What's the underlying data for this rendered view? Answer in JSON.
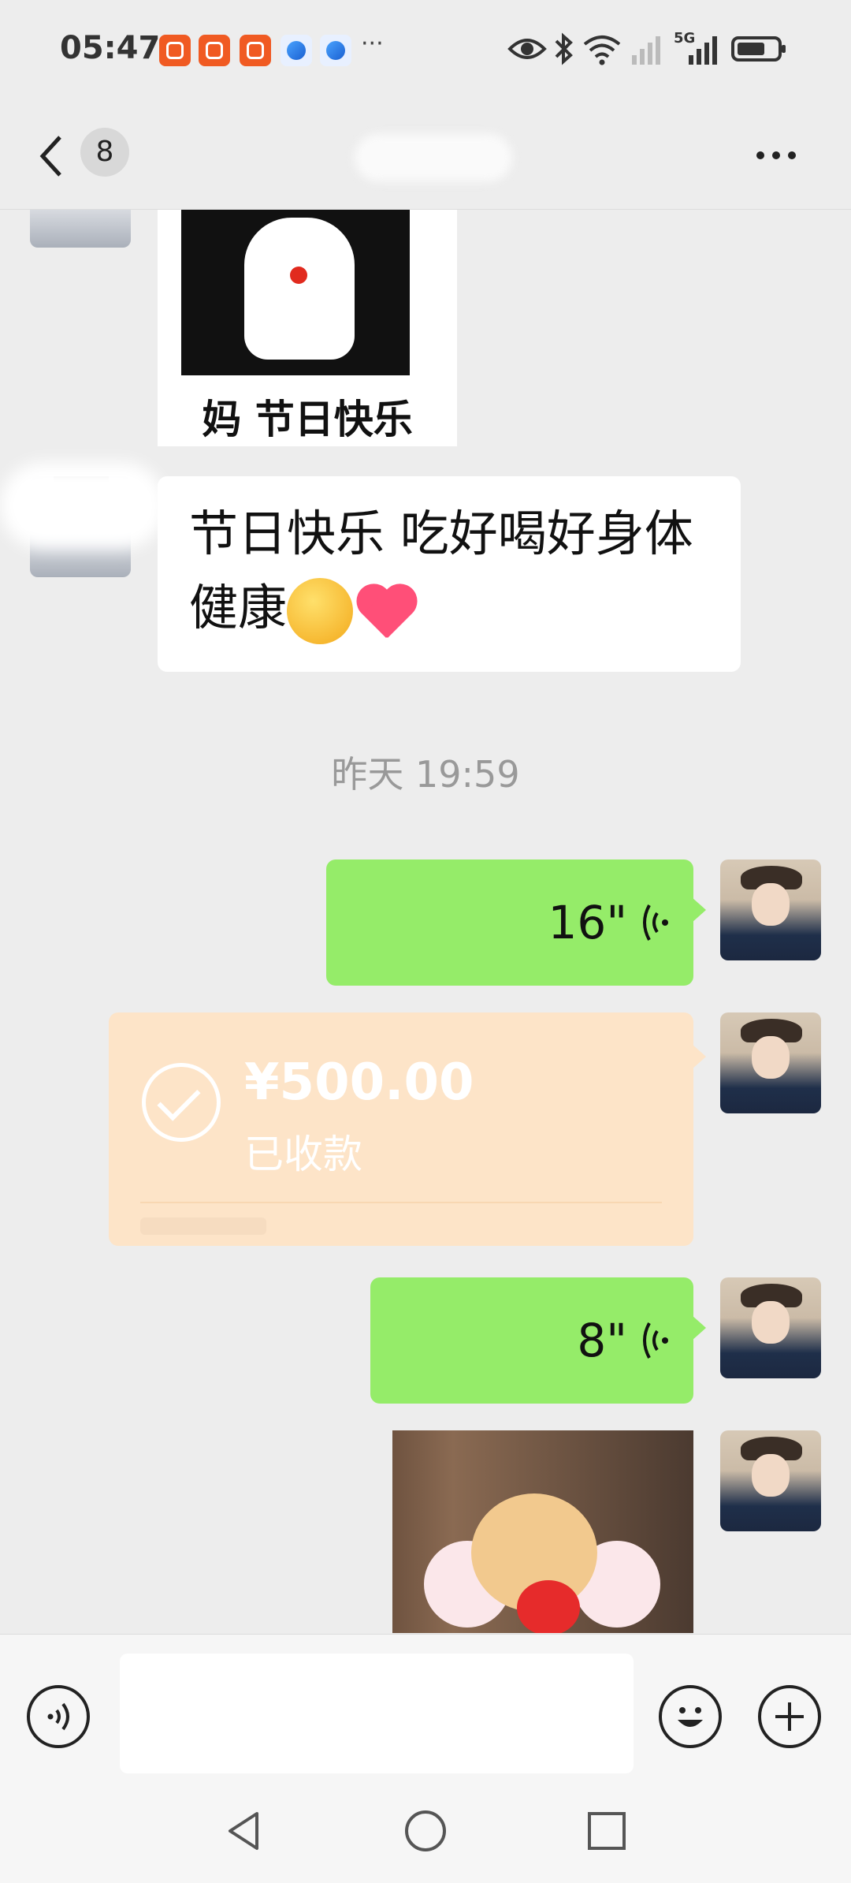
{
  "status_bar": {
    "time": "05:47",
    "more": "···",
    "network": "5G"
  },
  "header": {
    "unread_count": "8"
  },
  "messages": {
    "sticker_mom_caption": "妈  节日快乐",
    "greeting_text": "节日快乐  吃好喝好身体健康",
    "timestamp": "昨天 19:59",
    "voice_1_duration": "16\"",
    "transfer_amount": "¥500.00",
    "transfer_status": "已收款",
    "voice_2_duration": "8\""
  },
  "colors": {
    "voice_bubble": "#95ec69",
    "transfer_card": "#fde4c8",
    "background": "#ededed"
  },
  "icons": {
    "back": "chevron-left-icon",
    "more": "more-horizontal-icon",
    "voice_mode": "voice-icon",
    "emoji": "emoji-icon",
    "plus": "plus-icon"
  }
}
